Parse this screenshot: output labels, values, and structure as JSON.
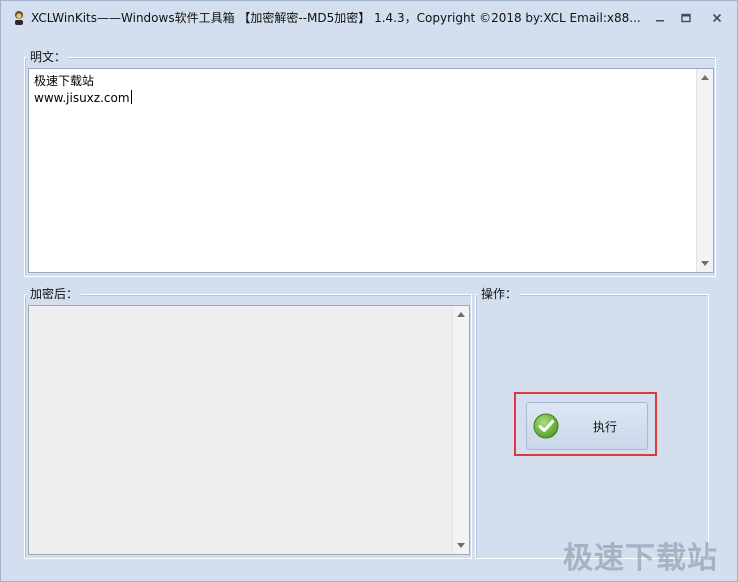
{
  "window": {
    "title": "XCLWinKits——Windows软件工具箱 【加密解密--MD5加密】 1.4.3，Copyright ©2018 by:XCL Email:x88..."
  },
  "icons": {
    "app": "app-icon",
    "minimize": "minimize-icon",
    "maximize": "maximize-icon",
    "close": "close-icon",
    "execute": "check-circle-icon"
  },
  "plaintext": {
    "label": "明文：",
    "lines": [
      "极速下载站",
      "www.jisuxz.com"
    ]
  },
  "encrypted": {
    "label": "加密后：",
    "value": ""
  },
  "operations": {
    "label": "操作：",
    "execute_label": "执行"
  },
  "watermark": "极速下载站",
  "colors": {
    "window_bg": "#d3dfee",
    "highlight": "#e0383c",
    "check_green": "#5aa832"
  }
}
